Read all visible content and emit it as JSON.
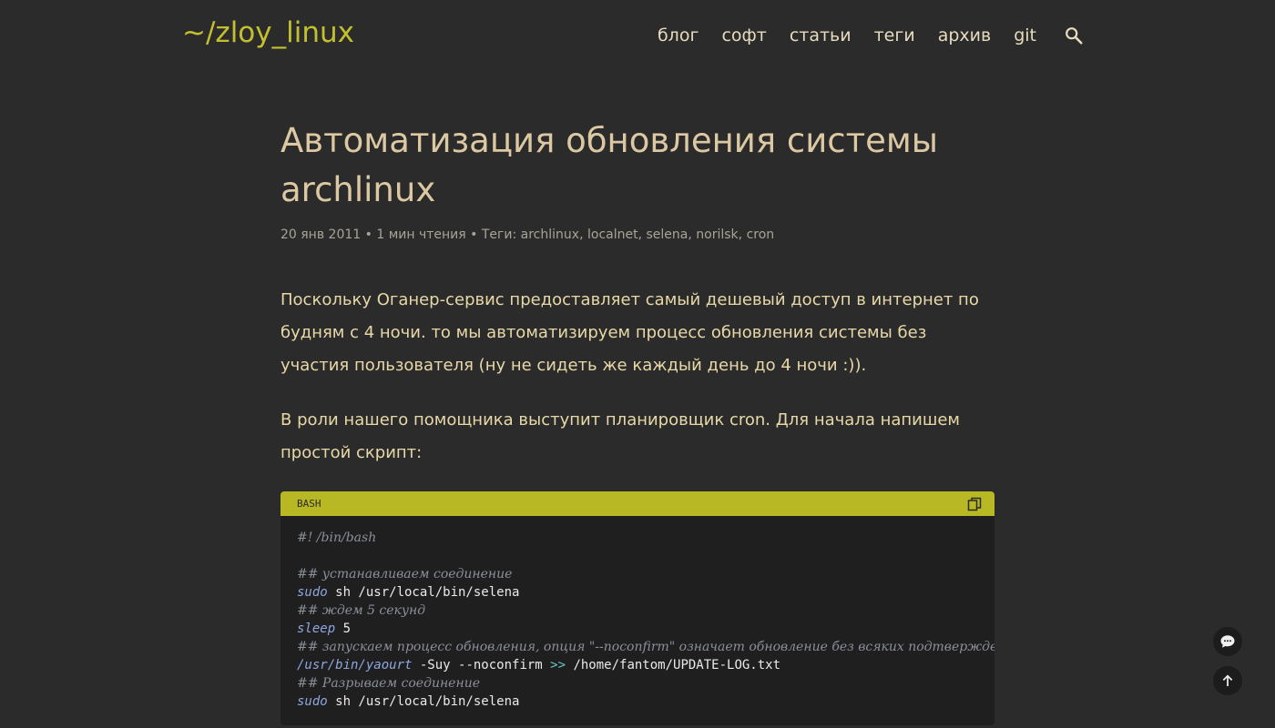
{
  "header": {
    "logo": "~/zloy_linux",
    "nav": [
      "блог",
      "софт",
      "статьи",
      "теги",
      "архив",
      "git"
    ],
    "search_icon": "search-icon"
  },
  "article": {
    "title": "Автоматизация обновления системы archlinux",
    "meta": {
      "date": "20 янв 2011",
      "sep": " • ",
      "read_time": "1 мин чтения",
      "tags_label": "Теги: ",
      "tags": [
        "archlinux",
        "localnet",
        "selena",
        "norilsk",
        "cron"
      ]
    },
    "paragraphs": [
      "Поскольку Оганер-сервис предоставляет самый дешевый доступ в интернет по будням с 4 ночи. то мы автоматизируем процесс обновления системы без участия пользователя (ну не сидеть же каждый день до 4 ночи :)).",
      "В роли нашего помощника выступит планировщик cron. Для начала напишем простой скрипт:"
    ],
    "code": {
      "lang": "BASH",
      "copy_icon": "copy-icon",
      "lines": {
        "l1": "#! /bin/bash",
        "l3": "## устанавливаем соединение",
        "l4_cmd": "sudo",
        "l4_rest": " sh /usr/local/bin/selena",
        "l5": "## ждем 5 секунд",
        "l6_cmd": "sleep",
        "l6_rest": " 5",
        "l7": "## запускаем процесс обновления, опция \"--noconfirm\" означает обновление без всяких подтверждений. Всё",
        "l8_cmd": "/usr/bin/yaourt",
        "l8_mid": " -Suy --noconfirm ",
        "l8_op": ">>",
        "l8_rest": " /home/fantom/UPDATE-LOG.txt",
        "l9": "## Разрываем соединение",
        "l10_cmd": "sudo",
        "l10_rest": " sh /usr/local/bin/selena"
      }
    }
  },
  "fabs": {
    "comments_icon": "comments-icon",
    "top_icon": "arrow-up-icon"
  },
  "colors": {
    "background": "#2b2b2b",
    "accent": "#c3c02f",
    "code_header": "#b8b824"
  }
}
